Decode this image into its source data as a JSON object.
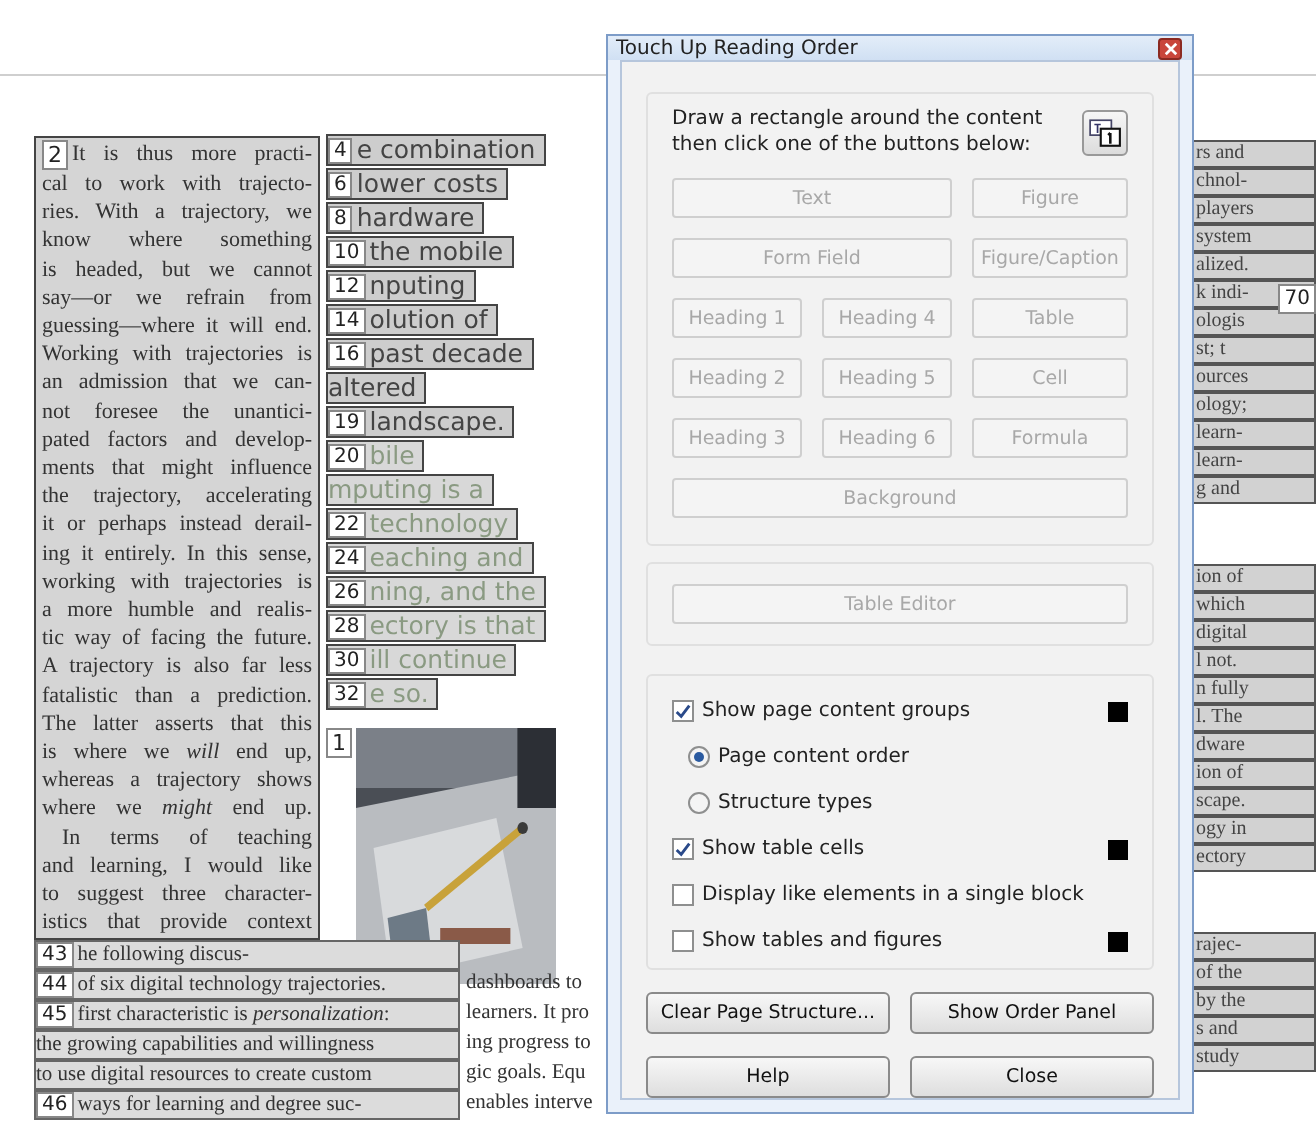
{
  "document": {
    "left_block": {
      "tag": "2",
      "lines": [
        {
          "text": "It is thus more practi-",
          "indent": false
        },
        {
          "text": "cal to work with trajecto-",
          "indent": false
        },
        {
          "text": "ries. With a trajectory, we",
          "indent": false
        },
        {
          "text": "know where something",
          "indent": false
        },
        {
          "text": "is headed, but we cannot",
          "indent": false
        },
        {
          "text": "say—or we refrain from",
          "indent": false
        },
        {
          "text": "guessing—where it will end.",
          "indent": false
        },
        {
          "text": "Working with trajectories is",
          "indent": false
        },
        {
          "text": "an admission that we can-",
          "indent": false
        },
        {
          "text": "not foresee the unantici-",
          "indent": false
        },
        {
          "text": "pated factors and develop-",
          "indent": false
        },
        {
          "text": "ments that might influence",
          "indent": false
        },
        {
          "text": "the trajectory, accelerating",
          "indent": false
        },
        {
          "text": "it or perhaps instead derail-",
          "indent": false
        },
        {
          "text": "ing it entirely. In this sense,",
          "indent": false
        },
        {
          "text": "working with trajectories is",
          "indent": false
        },
        {
          "text": "a more humble and realis-",
          "indent": false
        },
        {
          "text": "tic way of facing the future.",
          "indent": false
        },
        {
          "text": "A trajectory is also far less",
          "indent": false
        },
        {
          "text": "fatalistic than a prediction.",
          "indent": false
        },
        {
          "text": "The latter asserts that this",
          "indent": false
        },
        {
          "text": "is where we *will* end up,",
          "indent": false
        },
        {
          "text": "whereas a trajectory shows",
          "indent": false
        },
        {
          "text": "where we *might* end up.",
          "indent": false
        },
        {
          "text": "In terms of teaching",
          "indent": true
        },
        {
          "text": "and learning, I would like",
          "indent": false
        },
        {
          "text": "to suggest three character-",
          "indent": false
        },
        {
          "text": "istics that provide context",
          "indent": false
        }
      ]
    },
    "heading_lines": [
      {
        "tag": "4",
        "text": "e combination",
        "faded": false
      },
      {
        "tag": "6",
        "text": "lower costs",
        "faded": false
      },
      {
        "tag": "8",
        "text": "hardware",
        "faded": false
      },
      {
        "tag": "10",
        "text": "the mobile",
        "faded": false
      },
      {
        "tag": "12",
        "text": "nputing",
        "faded": false
      },
      {
        "tag": "14",
        "text": "olution of",
        "faded": false
      },
      {
        "tag": "16",
        "text": "past decade",
        "faded": false
      },
      {
        "text": "altered",
        "faded": false
      },
      {
        "tag": "19",
        "text": "landscape.",
        "faded": false
      },
      {
        "tag": "20",
        "text": "bile",
        "faded": true
      },
      {
        "text": "mputing is a",
        "faded": true
      },
      {
        "tag": "22",
        "text": "technology",
        "faded": true
      },
      {
        "tag": "24",
        "text": "eaching and",
        "faded": true
      },
      {
        "tag": "26",
        "text": "ning, and the",
        "faded": true
      },
      {
        "tag": "28",
        "text": "ectory is that",
        "faded": true
      },
      {
        "tag": "30",
        "text": "ill continue",
        "faded": true
      },
      {
        "tag": "32",
        "text": "e so.",
        "faded": true
      }
    ],
    "figure": {
      "tag": "1",
      "kind": "picture"
    },
    "bottom_lines": [
      {
        "tag": "43",
        "text": "he following discus-"
      },
      {
        "tag": "44",
        "text": "of six digital technology trajectories.",
        "next": "dashboards to"
      },
      {
        "tag": "45",
        "text": "first characteristic is *personalization*:",
        "next": "learners. It pro"
      },
      {
        "text": "the growing capabilities and willingness",
        "next": "ing progress to"
      },
      {
        "text": "to use digital resources to create custom",
        "next": "gic goals. Equ"
      },
      {
        "tag": "46",
        "text": "ways for learning and degree suc-",
        "next": "enables interve"
      }
    ],
    "right_groups": [
      {
        "tag": "70",
        "lines": [
          "rs and",
          "chnol-",
          "players",
          "system",
          "alized.",
          "k indi-",
          "ologis",
          "st; t",
          "ources",
          "ology;",
          "learn-",
          "learn-",
          "g and"
        ]
      },
      {
        "lines": [
          "ion of",
          "which",
          "digital",
          "l not.",
          "n fully",
          "l. The",
          "dware",
          "ion of",
          "scape.",
          "ogy in",
          "ectory"
        ]
      },
      {
        "lines": [
          "rajec-",
          "of the",
          "by the",
          "s and",
          "study"
        ]
      }
    ]
  },
  "dialog": {
    "title": "Touch Up Reading Order",
    "instruction": "Draw a rectangle around the content then click one of the buttons below:",
    "structure_buttons": [
      [
        {
          "label": "Text",
          "disabled": true
        },
        {
          "label": "Figure",
          "disabled": true
        }
      ],
      [
        {
          "label": "Form Field",
          "disabled": true
        },
        {
          "label": "Figure/Caption",
          "disabled": true
        }
      ],
      [
        {
          "label": "Heading 1",
          "disabled": true
        },
        {
          "label": "Heading 4",
          "disabled": true
        },
        {
          "label": "Table",
          "disabled": true
        }
      ],
      [
        {
          "label": "Heading 2",
          "disabled": true
        },
        {
          "label": "Heading 5",
          "disabled": true
        },
        {
          "label": "Cell",
          "disabled": true
        }
      ],
      [
        {
          "label": "Heading 3",
          "disabled": true
        },
        {
          "label": "Heading 6",
          "disabled": true
        },
        {
          "label": "Formula",
          "disabled": true
        }
      ],
      [
        {
          "label": "Background",
          "disabled": true
        }
      ]
    ],
    "table_editor": {
      "label": "Table Editor",
      "disabled": true
    },
    "options": [
      {
        "kind": "checkbox",
        "label": "Show page content groups",
        "checked": true,
        "swatch": true
      },
      {
        "kind": "radio",
        "label": "Page content order",
        "selected": true,
        "swatch": false
      },
      {
        "kind": "radio",
        "label": "Structure types",
        "selected": false,
        "swatch": false
      },
      {
        "kind": "checkbox",
        "label": "Show table cells",
        "checked": true,
        "swatch": true
      },
      {
        "kind": "checkbox",
        "label": "Display like elements in a single block",
        "checked": false,
        "swatch": false
      },
      {
        "kind": "checkbox",
        "label": "Show tables and figures",
        "checked": false,
        "swatch": true
      }
    ],
    "footer_buttons": [
      [
        {
          "label": "Clear Page Structure...",
          "disabled": false
        },
        {
          "label": "Show Order Panel",
          "disabled": false
        }
      ],
      [
        {
          "label": "Help",
          "disabled": false
        },
        {
          "label": "Close",
          "disabled": false
        }
      ]
    ]
  }
}
